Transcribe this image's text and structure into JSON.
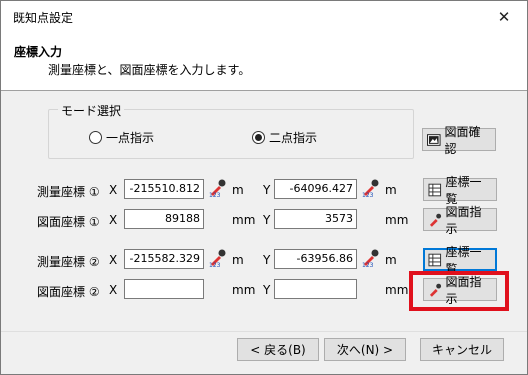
{
  "window": {
    "title": "既知点設定",
    "close_glyph": "✕"
  },
  "header": {
    "title": "座標入力",
    "description": "測量座標と、図面座標を入力します。"
  },
  "mode": {
    "legend": "モード選択",
    "option1": "一点指示",
    "option2": "二点指示",
    "selected": "二点指示"
  },
  "buttons": {
    "confirm": "図面確認",
    "list1": "座標一覧",
    "pick1": "図面指示",
    "list2": "座標一覧",
    "pick2": "図面指示"
  },
  "rows": [
    {
      "label": "測量座標 ①",
      "x_axis": "X",
      "x_value": "-215510.812",
      "x_unit": "m",
      "y_axis": "Y",
      "y_value": "-64096.427",
      "y_unit": "m"
    },
    {
      "label": "図面座標 ①",
      "x_axis": "X",
      "x_value": "89188",
      "x_unit": "mm",
      "y_axis": "Y",
      "y_value": "3573",
      "y_unit": "mm"
    },
    {
      "label": "測量座標 ②",
      "x_axis": "X",
      "x_value": "-215582.329",
      "x_unit": "m",
      "y_axis": "Y",
      "y_value": "-63956.86",
      "y_unit": "m"
    },
    {
      "label": "図面座標 ②",
      "x_axis": "X",
      "x_value": "",
      "x_unit": "mm",
      "y_axis": "Y",
      "y_value": "",
      "y_unit": "mm"
    }
  ],
  "footer": {
    "back": "< 戻る(B)",
    "next": "次へ(N) >",
    "cancel": "キャンセル"
  },
  "colors": {
    "highlight": "#e0101c",
    "accent": "#0078d7"
  },
  "icons": {
    "picker": "eyedropper-icon",
    "list": "table-icon",
    "confirm": "picture-icon"
  }
}
